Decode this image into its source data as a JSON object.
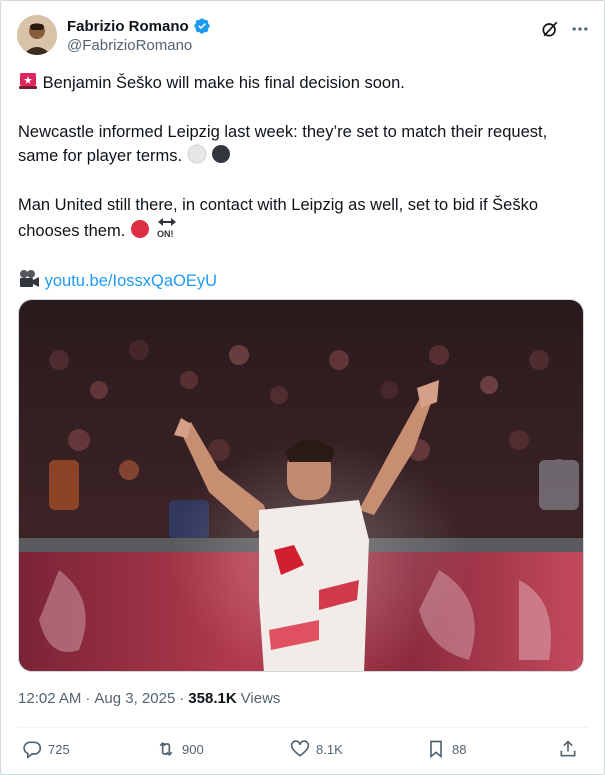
{
  "author": {
    "display_name": "Fabrizio Romano",
    "handle": "@FabrizioRomano"
  },
  "tweet": {
    "line1": "Benjamin Šeško will make his final decision soon.",
    "line2": "Newcastle informed Leipzig last week: they’re set to match their request, same for player terms.",
    "line3": "Man United still there, in contact with Leipzig as well, set to bid if Šeško chooses them.",
    "link": "youtu.be/IossxQaOEyU"
  },
  "meta": {
    "time": "12:02 AM",
    "date": "Aug 3, 2025",
    "views_count": "358.1K",
    "views_label": "Views"
  },
  "actions": {
    "replies": "725",
    "reposts": "900",
    "likes": "8.1K",
    "bookmarks": "88"
  },
  "colors": {
    "accent": "#1d9bf0",
    "text": "#0f1419",
    "muted": "#536471"
  }
}
